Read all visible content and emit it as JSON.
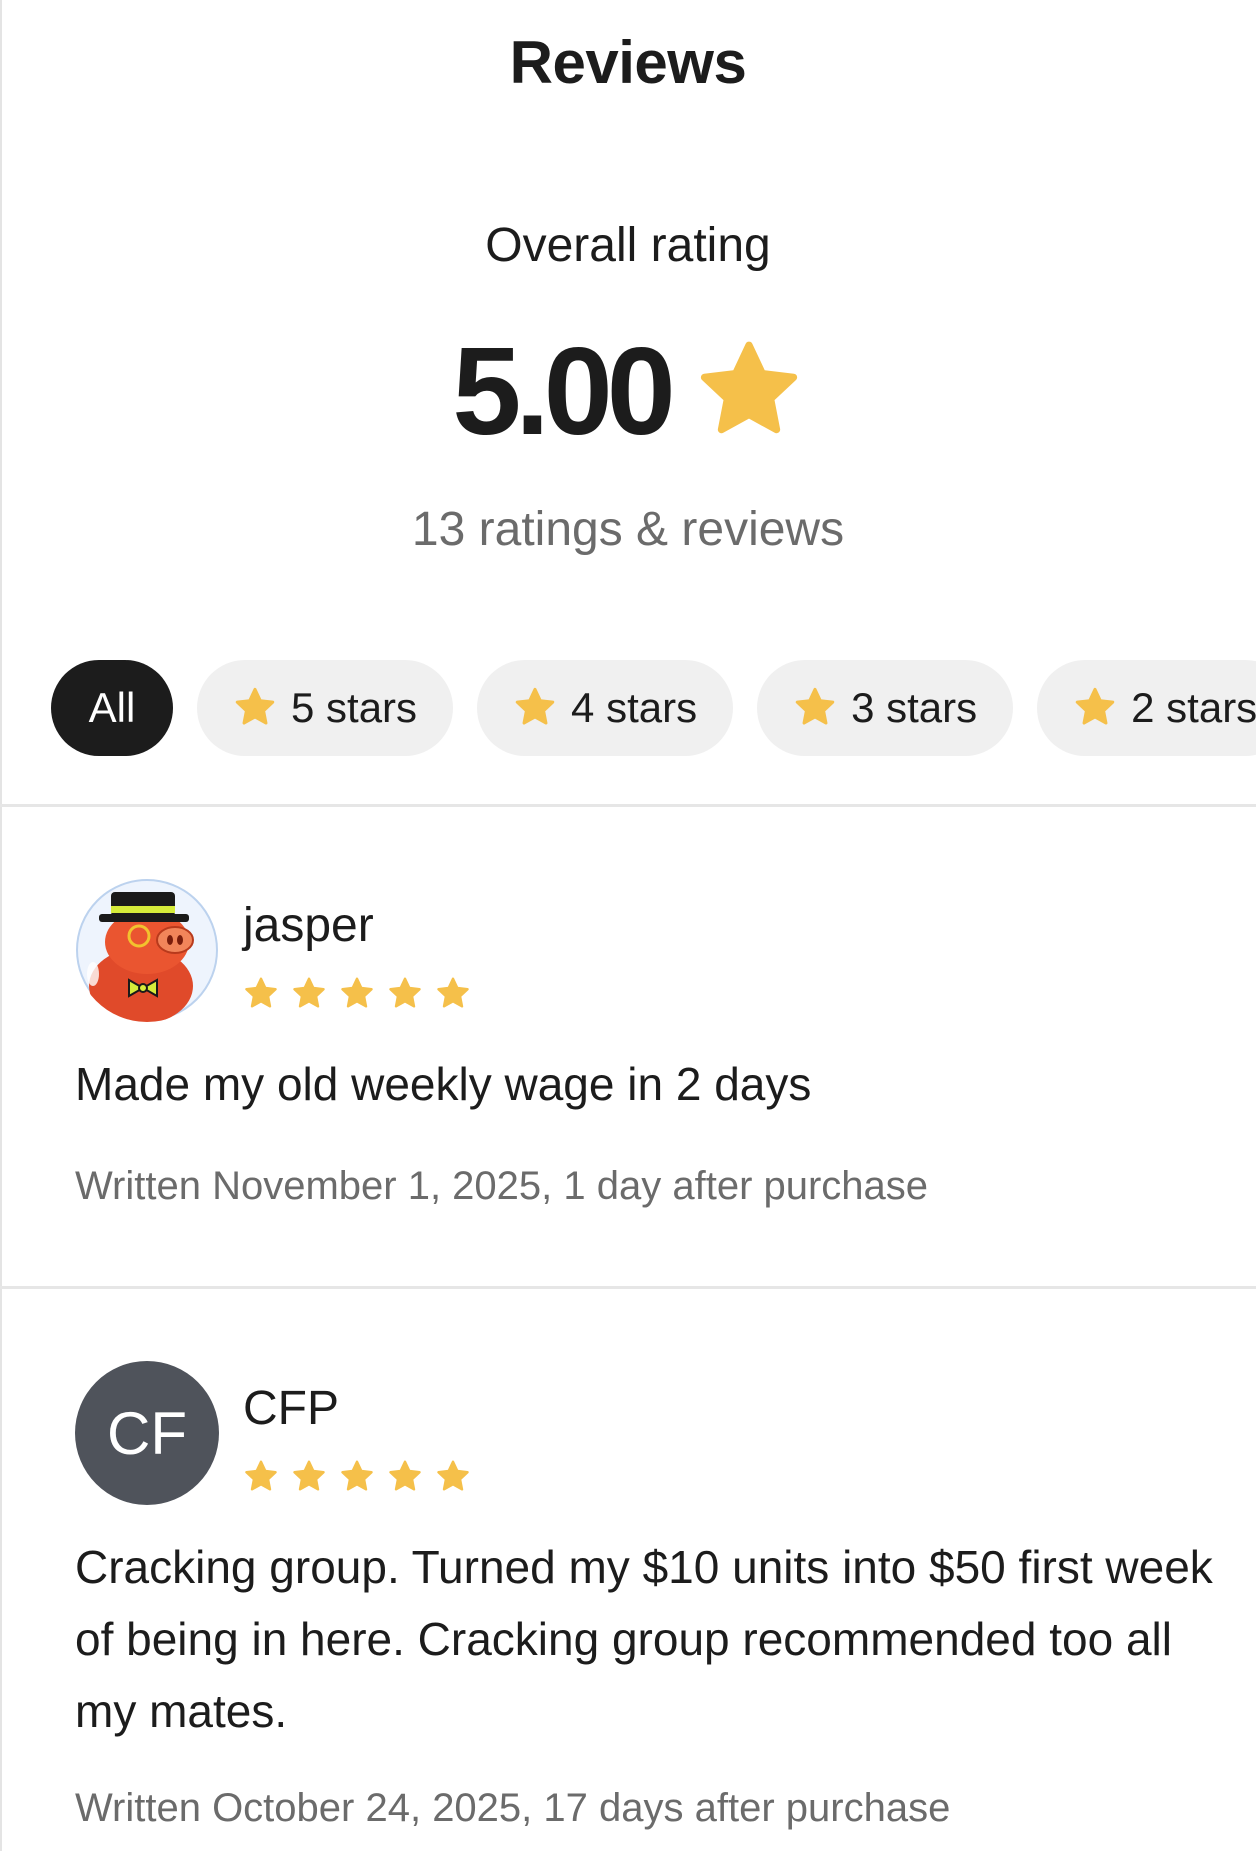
{
  "header": {
    "title": "Reviews"
  },
  "summary": {
    "label": "Overall rating",
    "value": "5.00",
    "count_text": "13 ratings & reviews",
    "star_color": "#F5C04A"
  },
  "filters": [
    {
      "label": "All",
      "active": true
    },
    {
      "label": "5 stars",
      "icon": "star-icon"
    },
    {
      "label": "4 stars",
      "icon": "star-icon"
    },
    {
      "label": "3 stars",
      "icon": "star-icon"
    },
    {
      "label": "2 stars",
      "icon": "star-icon"
    }
  ],
  "reviews": [
    {
      "name": "jasper",
      "avatar": "pig-mascot-avatar",
      "rating": 5,
      "text": "Made my old weekly wage in 2 days",
      "date_text": "Written November 1, 2025, 1 day after purchase"
    },
    {
      "name": "CFP",
      "avatar_initials": "CF",
      "rating": 5,
      "text": "Cracking group. Turned my $10 units into $50 first week of being in here. Cracking group recommended too all my mates.",
      "date_text": "Written October 24, 2025, 17 days after purchase"
    }
  ]
}
